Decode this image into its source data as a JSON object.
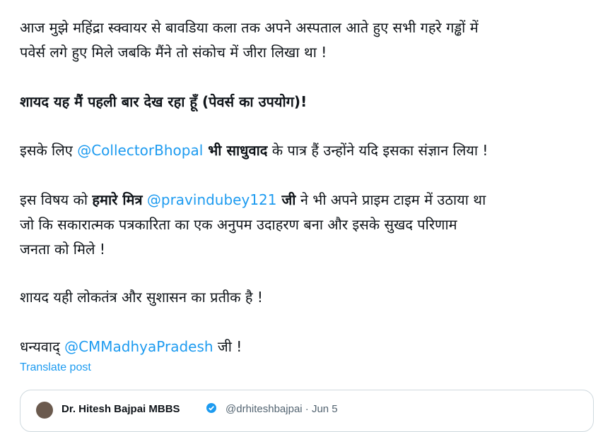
{
  "post": {
    "p1_l1": "आज मुझे महिंद्रा स्क्वायर से बावडिया कला तक अपने अस्पताल आते हुए सभी गहरे गड्ढों में",
    "p1_l2": "पवेर्स लगे हुए मिले जबकि मैंने तो संकोच में जीरा लिखा था !",
    "p2": "शायद यह मैं पहली बार देख रहा हूँ  (पेवर्स का उपयोग)!",
    "p3_a": "इसके लिए ",
    "p3_mention": "@CollectorBhopal",
    "p3_bold": " भी साधुवाद",
    "p3_b": " के पात्र हैं उन्होंने यदि इसका संज्ञान लिया !",
    "p4_a": "इस विषय को ",
    "p4_bold1": "हमारे मित्र",
    "p4_mention": " @pravindubey121",
    "p4_bold2": " जी",
    "p4_b": " ने भी अपने प्राइम टाइम में उठाया था",
    "p4_l2": "जो कि सकारात्मक पत्रकारिता का एक अनुपम उदाहरण बना और इसके सुखद परिणाम",
    "p4_l3": "जनता को मिले !",
    "p5": "शायद यही लोकतंत्र और सुशासन का प्रतीक है !",
    "p6_a": "धन्यवाद् ",
    "p6_mention": "@CMMadhyaPradesh",
    "p6_b": " जी !"
  },
  "translate_label": "Translate post",
  "quote": {
    "name": "Dr. Hitesh Bajpai MBBS",
    "meta": "@drhiteshbajpai · Jun 5"
  },
  "colors": {
    "link": "#1d9bf0",
    "text": "#0f1419",
    "border": "#cfd9de"
  }
}
